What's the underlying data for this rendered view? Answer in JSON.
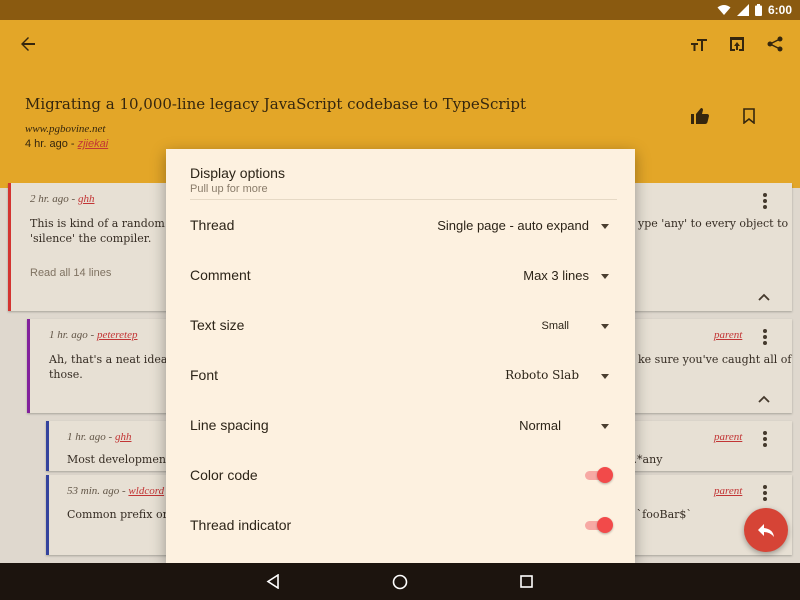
{
  "status_bar": {
    "time": "6:00",
    "network": "3G"
  },
  "app_bar": {
    "back_icon": "arrow-back-icon",
    "text_size_icon": "text-size-icon",
    "open_in_browser_icon": "open-in-browser-icon",
    "share_icon": "share-icon"
  },
  "story": {
    "title": "Migrating a 10,000-line legacy JavaScript codebase to TypeScript",
    "domain": "www.pgbovine.net",
    "age": "4 hr. ago - ",
    "author": "zjiekai",
    "upvote_icon": "thumb-up-icon",
    "bookmark_icon": "bookmark-icon"
  },
  "comments": [
    {
      "age": "2 hr. ago - ",
      "user": "ghh",
      "text_left": "This is kind of a random T",
      "text_right": "ype 'any' to every object to",
      "text_line2": "'silence' the compiler.",
      "read_all": "Read all 14 lines",
      "color": "#e53935"
    },
    {
      "age": "1 hr. ago - ",
      "user": "peteretep",
      "parent": "parent",
      "text_left": "Ah, that's a neat idea. I",
      "text_right": "ke sure you've caught all of",
      "text_line2": "those.",
      "color": "#8e24aa"
    },
    {
      "age": "1 hr. ago - ",
      "user": "ghh",
      "parent": "parent",
      "text_left": "Most development",
      "text_right": "pe.*any",
      "color": "#3949ab"
    },
    {
      "age": "53 min. ago - ",
      "user": "wldcord",
      "parent": "parent",
      "text_left": "Common prefix or s",
      "text_right": "ke `fooBar$`",
      "color": "#3949ab"
    }
  ],
  "dialog": {
    "title": "Display options",
    "subtitle": "Pull up for more",
    "options": [
      {
        "label": "Thread",
        "value": "Single page - auto expand"
      },
      {
        "label": "Comment",
        "value": "Max 3 lines"
      },
      {
        "label": "Text size",
        "value": "Small"
      },
      {
        "label": "Font",
        "value": "Roboto Slab"
      },
      {
        "label": "Line spacing",
        "value": "Normal"
      },
      {
        "label": "Color code",
        "toggle": true
      },
      {
        "label": "Thread indicator",
        "toggle": true
      }
    ]
  },
  "fab": {
    "icon": "reply-icon"
  },
  "nav": {
    "back": "nav-back-icon",
    "home": "nav-home-icon",
    "recents": "nav-recents-icon"
  },
  "colors": {
    "accent": "#f7b52c",
    "toggle_on": "#f24a4a",
    "fab": "#d64436"
  }
}
